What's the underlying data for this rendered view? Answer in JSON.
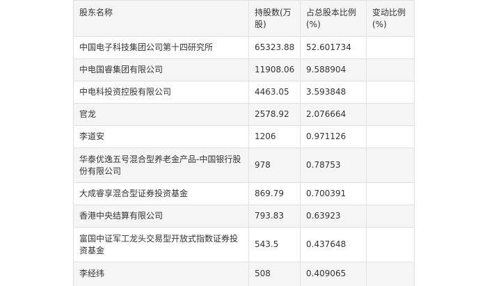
{
  "table": {
    "headers": [
      "股东名称",
      "持股数(万股)",
      "占总股本比例(%)",
      "变动比例(%)"
    ],
    "rows": [
      [
        "中国电子科技集团公司第十四研究所",
        "65323.88",
        "52.601734",
        ""
      ],
      [
        "中电国睿集团有限公司",
        "11908.06",
        "9.588904",
        ""
      ],
      [
        "中电科投资控股有限公司",
        "4463.05",
        "3.593848",
        ""
      ],
      [
        "官龙",
        "2578.92",
        "2.076664",
        ""
      ],
      [
        "李道安",
        "1206",
        "0.971126",
        ""
      ],
      [
        "华泰优逸五号混合型养老金产品-中国银行股份有限公司",
        "978",
        "0.78753",
        ""
      ],
      [
        "大成睿享混合型证券投资基金",
        "869.79",
        "0.700391",
        ""
      ],
      [
        "香港中央结算有限公司",
        "793.83",
        "0.63923",
        ""
      ],
      [
        "富国中证军工龙头交易型开放式指数证券投资基金",
        "543.5",
        "0.437648",
        ""
      ],
      [
        "李经纬",
        "508",
        "0.409065",
        ""
      ]
    ]
  }
}
